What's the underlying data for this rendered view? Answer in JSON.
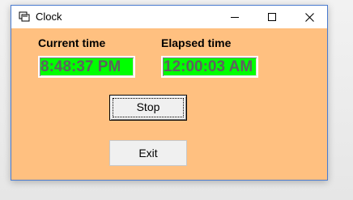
{
  "window": {
    "title": "Clock",
    "app_icon": "clock-app-icon",
    "controls": {
      "minimize_icon": "minimize-icon",
      "maximize_icon": "maximize-icon",
      "close_icon": "close-icon"
    }
  },
  "labels": {
    "current_time": "Current time",
    "elapsed_time": "Elapsed time"
  },
  "displays": {
    "current_time": "8:48:37 PM",
    "elapsed_time": "12:00:03 AM"
  },
  "buttons": {
    "stop": "Stop",
    "exit": "Exit"
  },
  "colors": {
    "form_background": "#ffc080",
    "display_background": "#00ff00",
    "display_text": "#606060"
  }
}
